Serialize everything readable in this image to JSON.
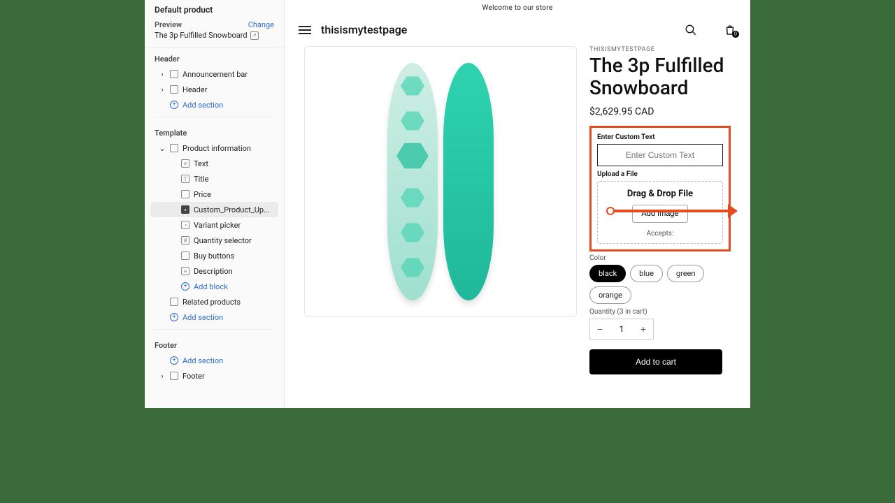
{
  "sidebar": {
    "default_product": "Default product",
    "preview_label": "Preview",
    "change": "Change",
    "preview_value": "The 3p Fulfilled Snowboard",
    "header_title": "Header",
    "header_items": [
      "Announcement bar",
      "Header"
    ],
    "add_section": "Add section",
    "template_title": "Template",
    "product_info": "Product information",
    "blocks": [
      "Text",
      "Title",
      "Price",
      "Custom_Product_Up...",
      "Variant picker",
      "Quantity selector",
      "Buy buttons",
      "Description"
    ],
    "add_block": "Add block",
    "related": "Related products",
    "footer_title": "Footer",
    "footer_item": "Footer"
  },
  "preview": {
    "announce": "Welcome to our store",
    "brand": "thisismytestpage",
    "bag_count": "0",
    "vendor": "THISISMYTESTPAGE",
    "title": "The 3p Fulfilled Snowboard",
    "price": "$2,629.95 CAD",
    "custom_text_label": "Enter Custom Text",
    "custom_text_ph": "Enter Custom Text",
    "upload_label": "Upload a File",
    "dz_title": "Drag & Drop File",
    "dz_button": "Add Image",
    "dz_accepts": "Accepts:",
    "color_label": "Color",
    "colors": [
      "black",
      "blue",
      "green",
      "orange"
    ],
    "qty_label": "Quantity (3 in cart)",
    "qty_value": "1",
    "atc": "Add to cart"
  }
}
